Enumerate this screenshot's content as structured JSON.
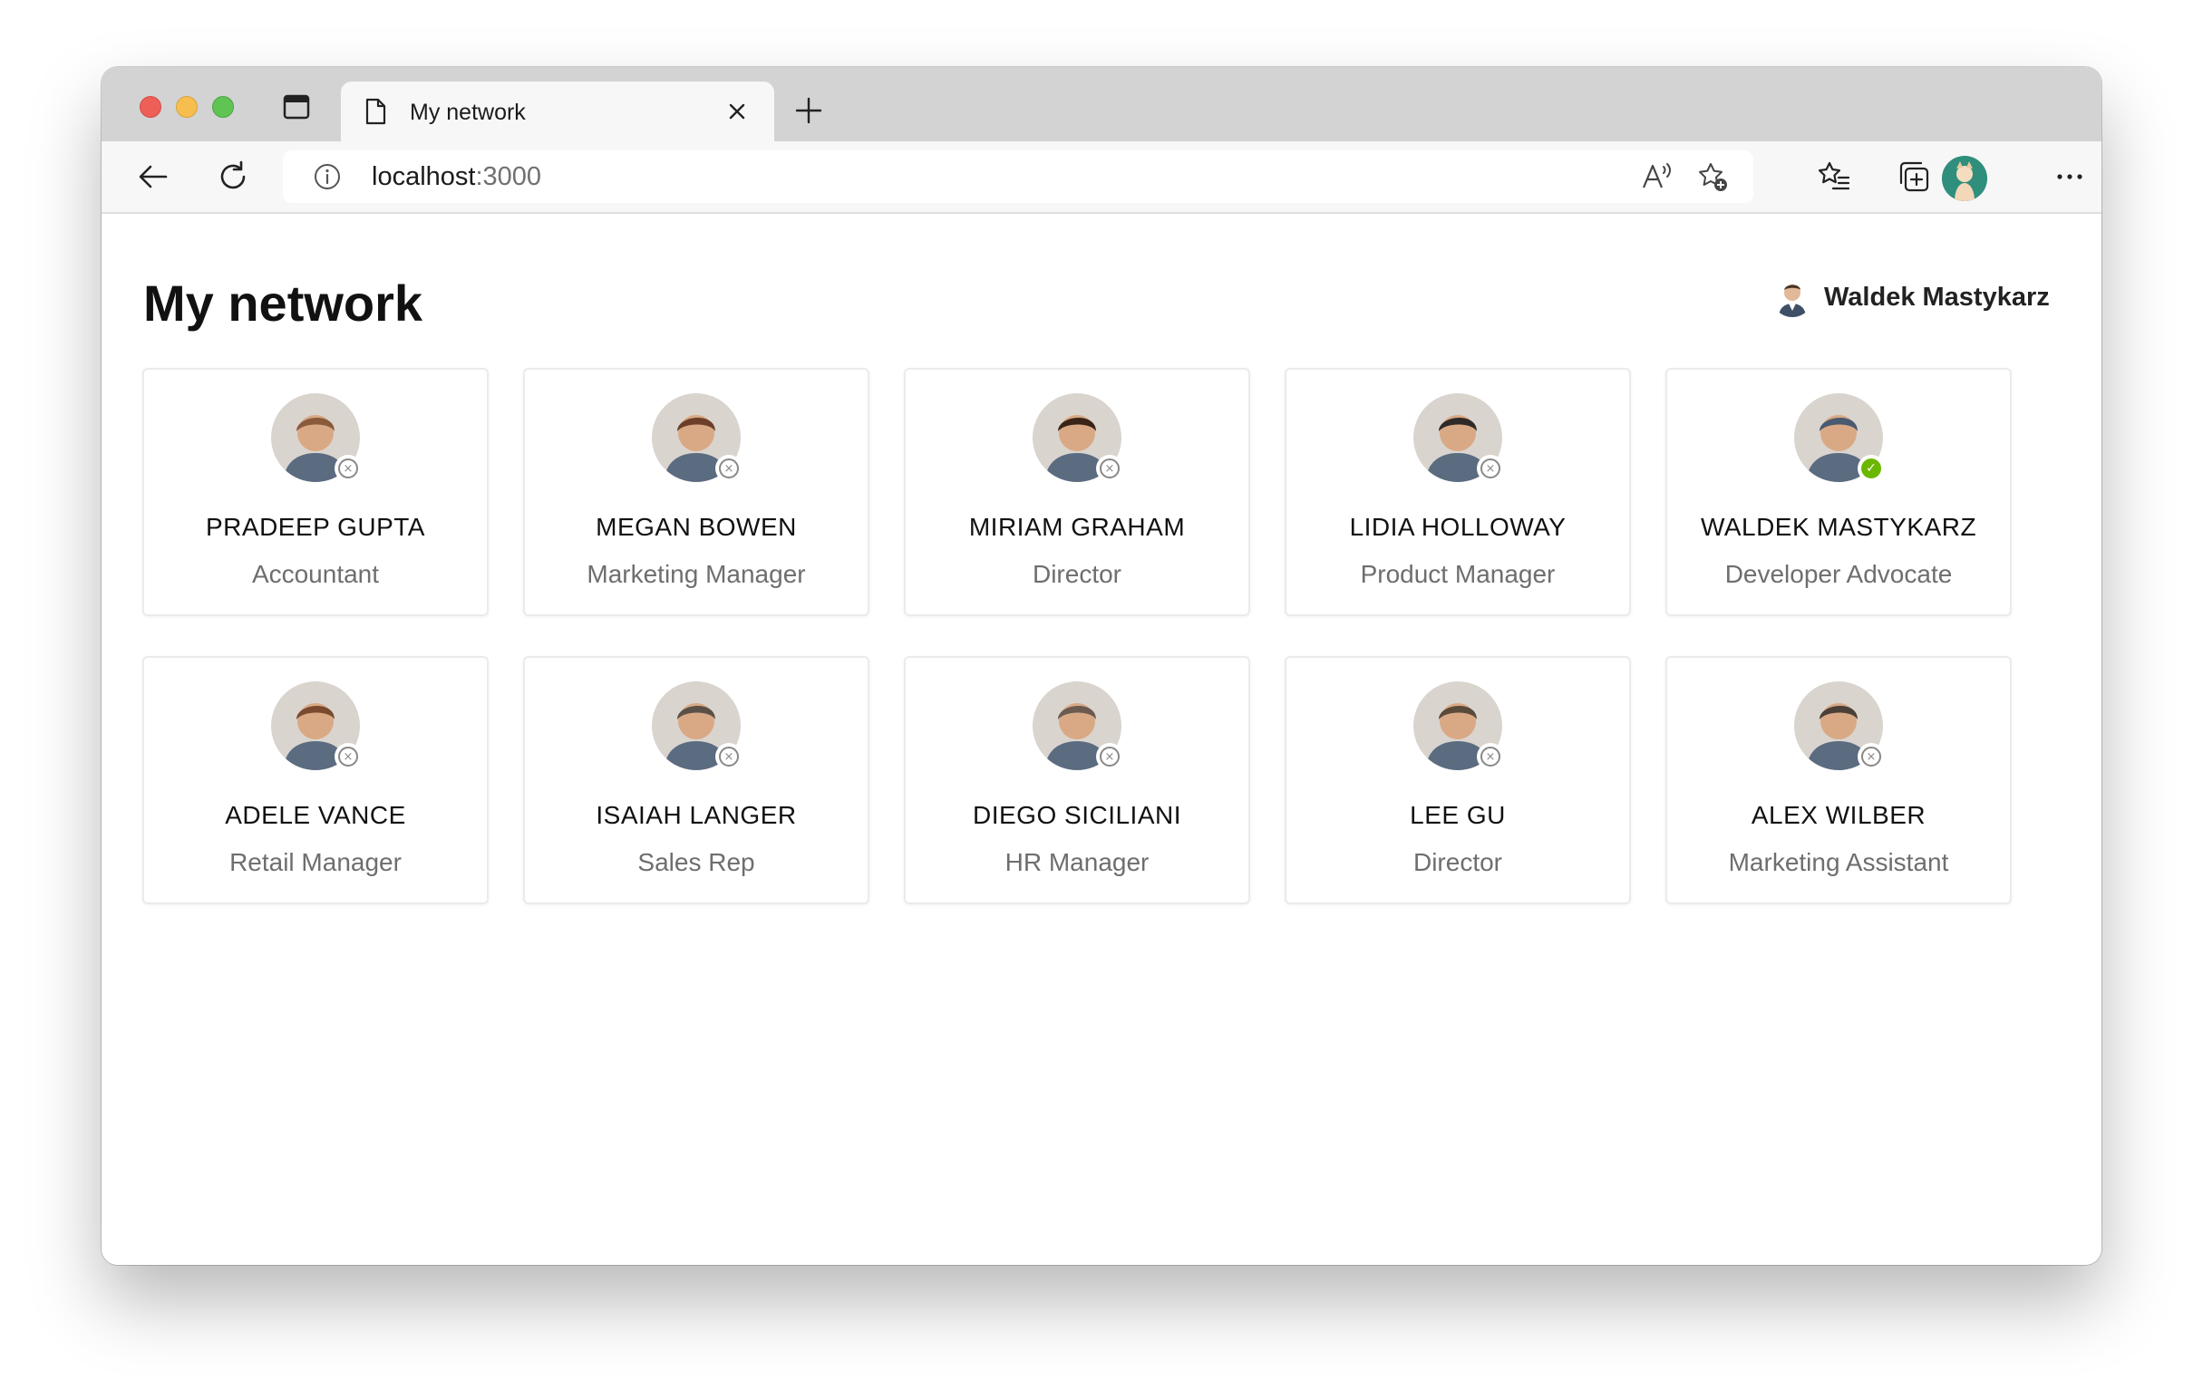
{
  "browser": {
    "tab_title": "My network",
    "url_host": "localhost",
    "url_port": ":3000"
  },
  "page": {
    "title": "My network",
    "signed_in_user": "Waldek Mastykarz"
  },
  "people": [
    {
      "name": "PRADEEP GUPTA",
      "title": "Accountant",
      "presence": "offline",
      "avatar_color": "#8a5a3c"
    },
    {
      "name": "MEGAN BOWEN",
      "title": "Marketing Manager",
      "presence": "offline",
      "avatar_color": "#6b3f2a"
    },
    {
      "name": "MIRIAM GRAHAM",
      "title": "Director",
      "presence": "offline",
      "avatar_color": "#3a2418"
    },
    {
      "name": "LIDIA HOLLOWAY",
      "title": "Product Manager",
      "presence": "offline",
      "avatar_color": "#2f2a28"
    },
    {
      "name": "WALDEK MASTYKARZ",
      "title": "Developer Advocate",
      "presence": "available",
      "avatar_color": "#4a5a70"
    },
    {
      "name": "ADELE VANCE",
      "title": "Retail Manager",
      "presence": "offline",
      "avatar_color": "#7a4a2e"
    },
    {
      "name": "ISAIAH LANGER",
      "title": "Sales Rep",
      "presence": "offline",
      "avatar_color": "#5a5048"
    },
    {
      "name": "DIEGO SICILIANI",
      "title": "HR Manager",
      "presence": "offline",
      "avatar_color": "#6a5a50"
    },
    {
      "name": "LEE GU",
      "title": "Director",
      "presence": "offline",
      "avatar_color": "#5a4a3a"
    },
    {
      "name": "ALEX WILBER",
      "title": "Marketing Assistant",
      "presence": "offline",
      "avatar_color": "#4a4038"
    }
  ]
}
